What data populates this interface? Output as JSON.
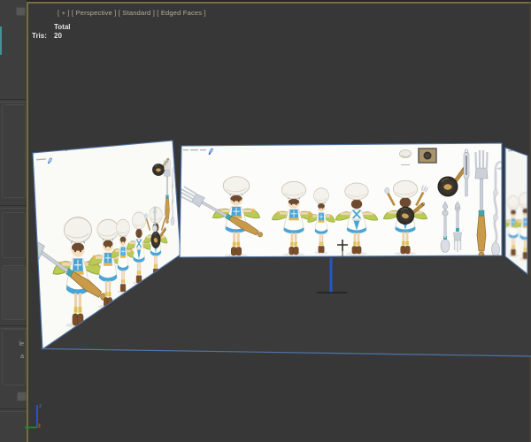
{
  "command_panel": {
    "fragments": [
      "le",
      "a"
    ]
  },
  "viewport": {
    "header_label": "[ + ] [ Perspective ] [ Standard ] [ Edged Faces ]",
    "stats": {
      "column_header": "Total",
      "row_label": "Tris:",
      "row_value": "20"
    }
  },
  "scene": {
    "planes": [
      "left-reference-plane",
      "front-reference-plane",
      "right-reference-plane",
      "floor-plane"
    ],
    "axis_tripod": {
      "z_label": "z"
    }
  },
  "colors": {
    "viewport_background": "#373737",
    "panel_background": "#3e3e3e",
    "active_viewport_border": "#776d3e",
    "plane_edge_blue": "#5076a8",
    "selection_blue": "#2257c9",
    "axis_z_blue": "#2a50cc",
    "axis_x_green": "#208a20",
    "axis_y_red": "#c23a2a",
    "header_text": "#b3b09a",
    "stats_text": "#e5e5e5"
  }
}
